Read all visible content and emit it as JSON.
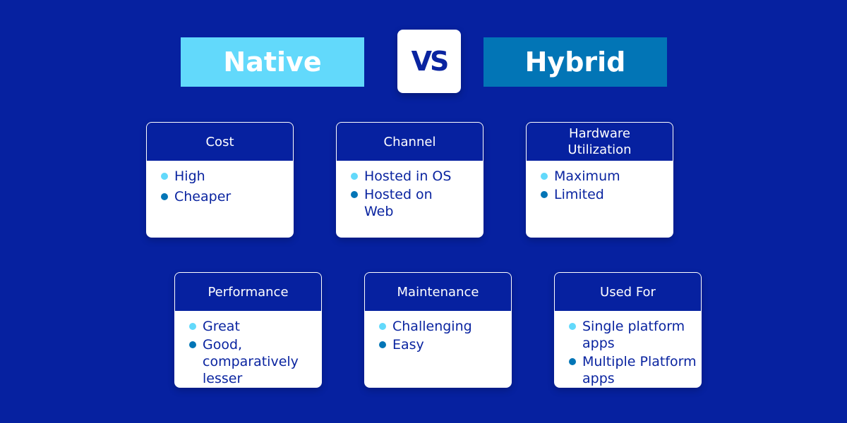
{
  "header": {
    "left": "Native",
    "vs": "VS",
    "right": "Hybrid"
  },
  "colors": {
    "background": "#0621a0",
    "native": "#62d9fb",
    "hybrid": "#0275b6",
    "text": "#0a24a0"
  },
  "cards": [
    {
      "title": "Cost",
      "native": "High",
      "hybrid": "Cheaper"
    },
    {
      "title": "Channel",
      "native": "Hosted in OS",
      "hybrid": "Hosted on Web"
    },
    {
      "title": "Hardware Utilization",
      "native": "Maximum",
      "hybrid": "Limited"
    },
    {
      "title": "Performance",
      "native": "Great",
      "hybrid": "Good, comparatively lesser"
    },
    {
      "title": "Maintenance",
      "native": "Challenging",
      "hybrid": "Easy"
    },
    {
      "title": "Used For",
      "native": "Single platform apps",
      "hybrid": "Multiple Platform apps"
    }
  ]
}
